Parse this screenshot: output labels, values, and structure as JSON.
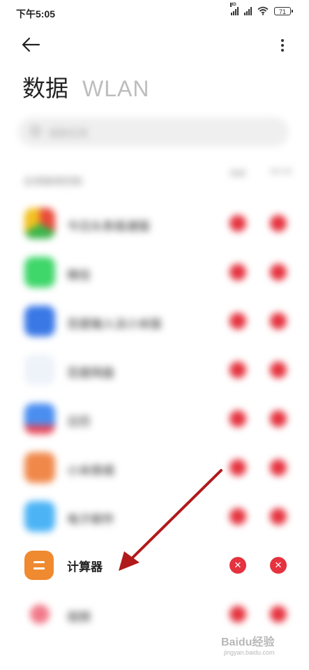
{
  "status_bar": {
    "time": "下午5:05",
    "battery": "71"
  },
  "tabs": [
    {
      "label": "数据"
    },
    {
      "label": "WLAN"
    }
  ],
  "search": {
    "placeholder": "搜索应用"
  },
  "list": {
    "header": "应用联网控制",
    "col1": "数据",
    "col2": "WLAN"
  },
  "apps": [
    {
      "name": "今日头条极速版",
      "color": "#e8c04a"
    },
    {
      "name": "微信",
      "color": "#3fd66a"
    },
    {
      "name": "百度输入法小米版",
      "color": "#3a78e6"
    },
    {
      "name": "百度网盘",
      "color": "#b8cde8"
    },
    {
      "name": "日历",
      "color": "#4a8ef0"
    },
    {
      "name": "小米商城",
      "color": "#f0884a"
    },
    {
      "name": "电子邮件",
      "color": "#4cb4f5"
    },
    {
      "name": "计算器",
      "color": "#f08a30"
    },
    {
      "name": "视频",
      "color": "#f27a8a"
    }
  ],
  "accent": "#e5323e",
  "arrow_color": "#b11a1a",
  "watermark": {
    "title": "Baidu经验",
    "sub": "jingyan.baidu.com"
  }
}
